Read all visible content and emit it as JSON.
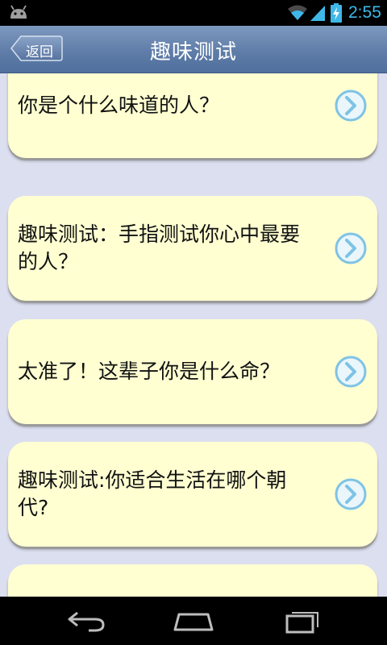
{
  "status_bar": {
    "time": "2:55",
    "icons": [
      "android-icon",
      "wifi-icon",
      "signal-icon",
      "battery-charging-icon"
    ],
    "time_color": "#3fb8e8"
  },
  "header": {
    "back_label": "返回",
    "title": "趣味测试",
    "bg_color": "#6a88b2"
  },
  "list": {
    "items": [
      {
        "text": "你是个什么味道的人？"
      },
      {
        "text": "趣味测试：手指测试你心中最要的人？"
      },
      {
        "text": "太准了！这辈子你是什么命？"
      },
      {
        "text": "趣味测试:你适合生活在哪个朝代?"
      },
      {
        "text": ""
      }
    ],
    "card_color": "#ffffd2",
    "arrow_color": "#7ec3e6"
  },
  "nav_bar": {
    "buttons": [
      "back-nav-icon",
      "home-nav-icon",
      "recent-apps-icon"
    ]
  }
}
